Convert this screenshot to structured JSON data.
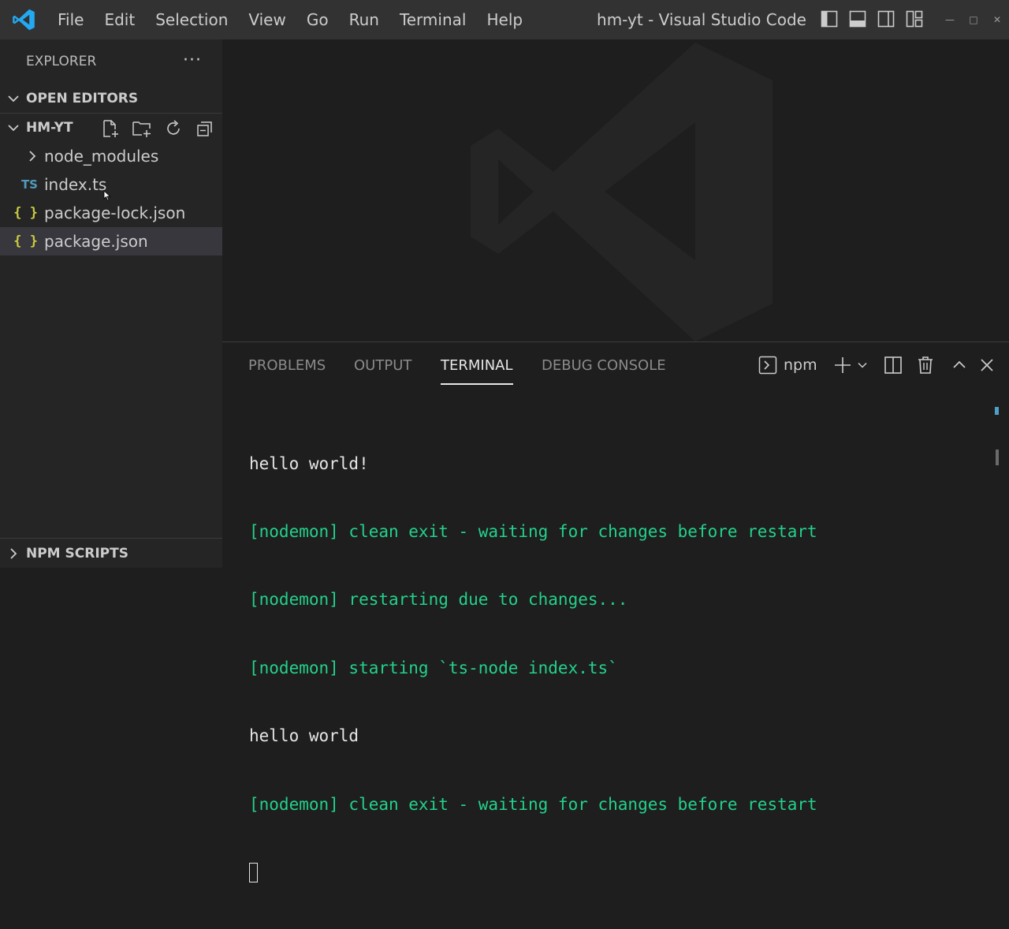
{
  "titlebar": {
    "menu": [
      "File",
      "Edit",
      "Selection",
      "View",
      "Go",
      "Run",
      "Terminal",
      "Help"
    ],
    "window_title": "hm-yt - Visual Studio Code"
  },
  "sidebar": {
    "header": "EXPLORER",
    "open_editors": "OPEN EDITORS",
    "project": "HM-YT",
    "tree": [
      {
        "name": "node_modules",
        "type": "folder"
      },
      {
        "name": "index.ts",
        "type": "ts",
        "icon_text": "TS"
      },
      {
        "name": "package-lock.json",
        "type": "json",
        "icon_text": "{ }"
      },
      {
        "name": "package.json",
        "type": "json",
        "icon_text": "{ }"
      }
    ],
    "npm_scripts": "NPM SCRIPTS"
  },
  "panel": {
    "tabs": [
      "PROBLEMS",
      "OUTPUT",
      "TERMINAL",
      "DEBUG CONSOLE"
    ],
    "active_tab": "TERMINAL",
    "terminal_name": "npm",
    "lines": [
      {
        "text": "hello world!",
        "color": "white"
      },
      {
        "text": "[nodemon] clean exit - waiting for changes before restart",
        "color": "green"
      },
      {
        "text": "[nodemon] restarting due to changes...",
        "color": "green"
      },
      {
        "text": "[nodemon] starting `ts-node index.ts`",
        "color": "green"
      },
      {
        "text": "hello world",
        "color": "white"
      },
      {
        "text": "[nodemon] clean exit - waiting for changes before restart",
        "color": "green"
      }
    ]
  },
  "colors": {
    "titlebar": "#323233",
    "sidebar": "#252526",
    "editor": "#1e1e1e",
    "terminal_green": "#23d18b",
    "ts_blue": "#519aba",
    "json_yellow": "#cbcb41",
    "vscode_blue": "#23a9f2"
  },
  "icons": {
    "app": "vscode-logo-icon",
    "more": "ellipsis-icon",
    "new_file": "new-file-icon",
    "new_folder": "new-folder-icon",
    "refresh": "refresh-icon",
    "collapse": "collapse-all-icon",
    "terminal": "terminal-icon",
    "add": "plus-icon",
    "split": "split-icon",
    "trash": "trash-icon",
    "maximize": "chevron-up-icon",
    "close": "close-icon"
  }
}
